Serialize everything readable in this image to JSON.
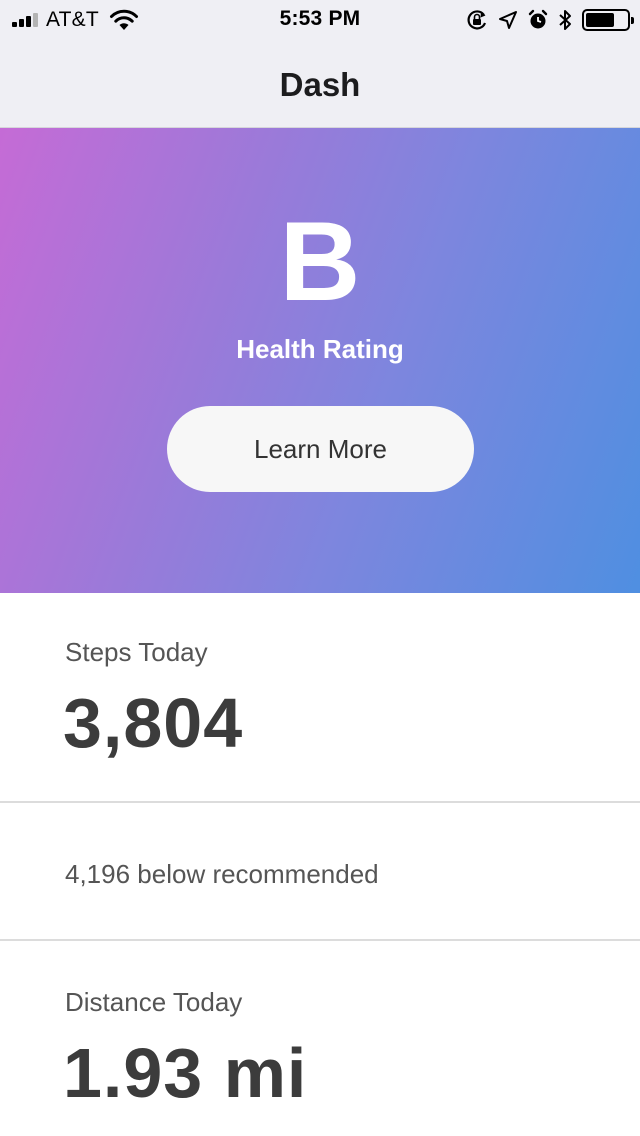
{
  "status_bar": {
    "carrier": "AT&T",
    "time": "5:53 PM",
    "battery_level": 0.7,
    "signal_bars_active": 3,
    "signal_bars_total": 4,
    "icons": [
      "cellular-signal-icon",
      "wifi-icon",
      "orientation-lock-icon",
      "location-arrow-icon",
      "alarm-icon",
      "bluetooth-icon",
      "battery-icon"
    ]
  },
  "nav": {
    "title": "Dash"
  },
  "hero": {
    "grade": "B",
    "label": "Health Rating",
    "button_label": "Learn More",
    "gradient_colors": [
      "#c56bd6",
      "#4f8fe1"
    ]
  },
  "steps": {
    "label": "Steps Today",
    "value": "3,804"
  },
  "recommendation": {
    "text": "4,196 below recommended"
  },
  "distance": {
    "label": "Distance Today",
    "value": "1.93 mi"
  }
}
